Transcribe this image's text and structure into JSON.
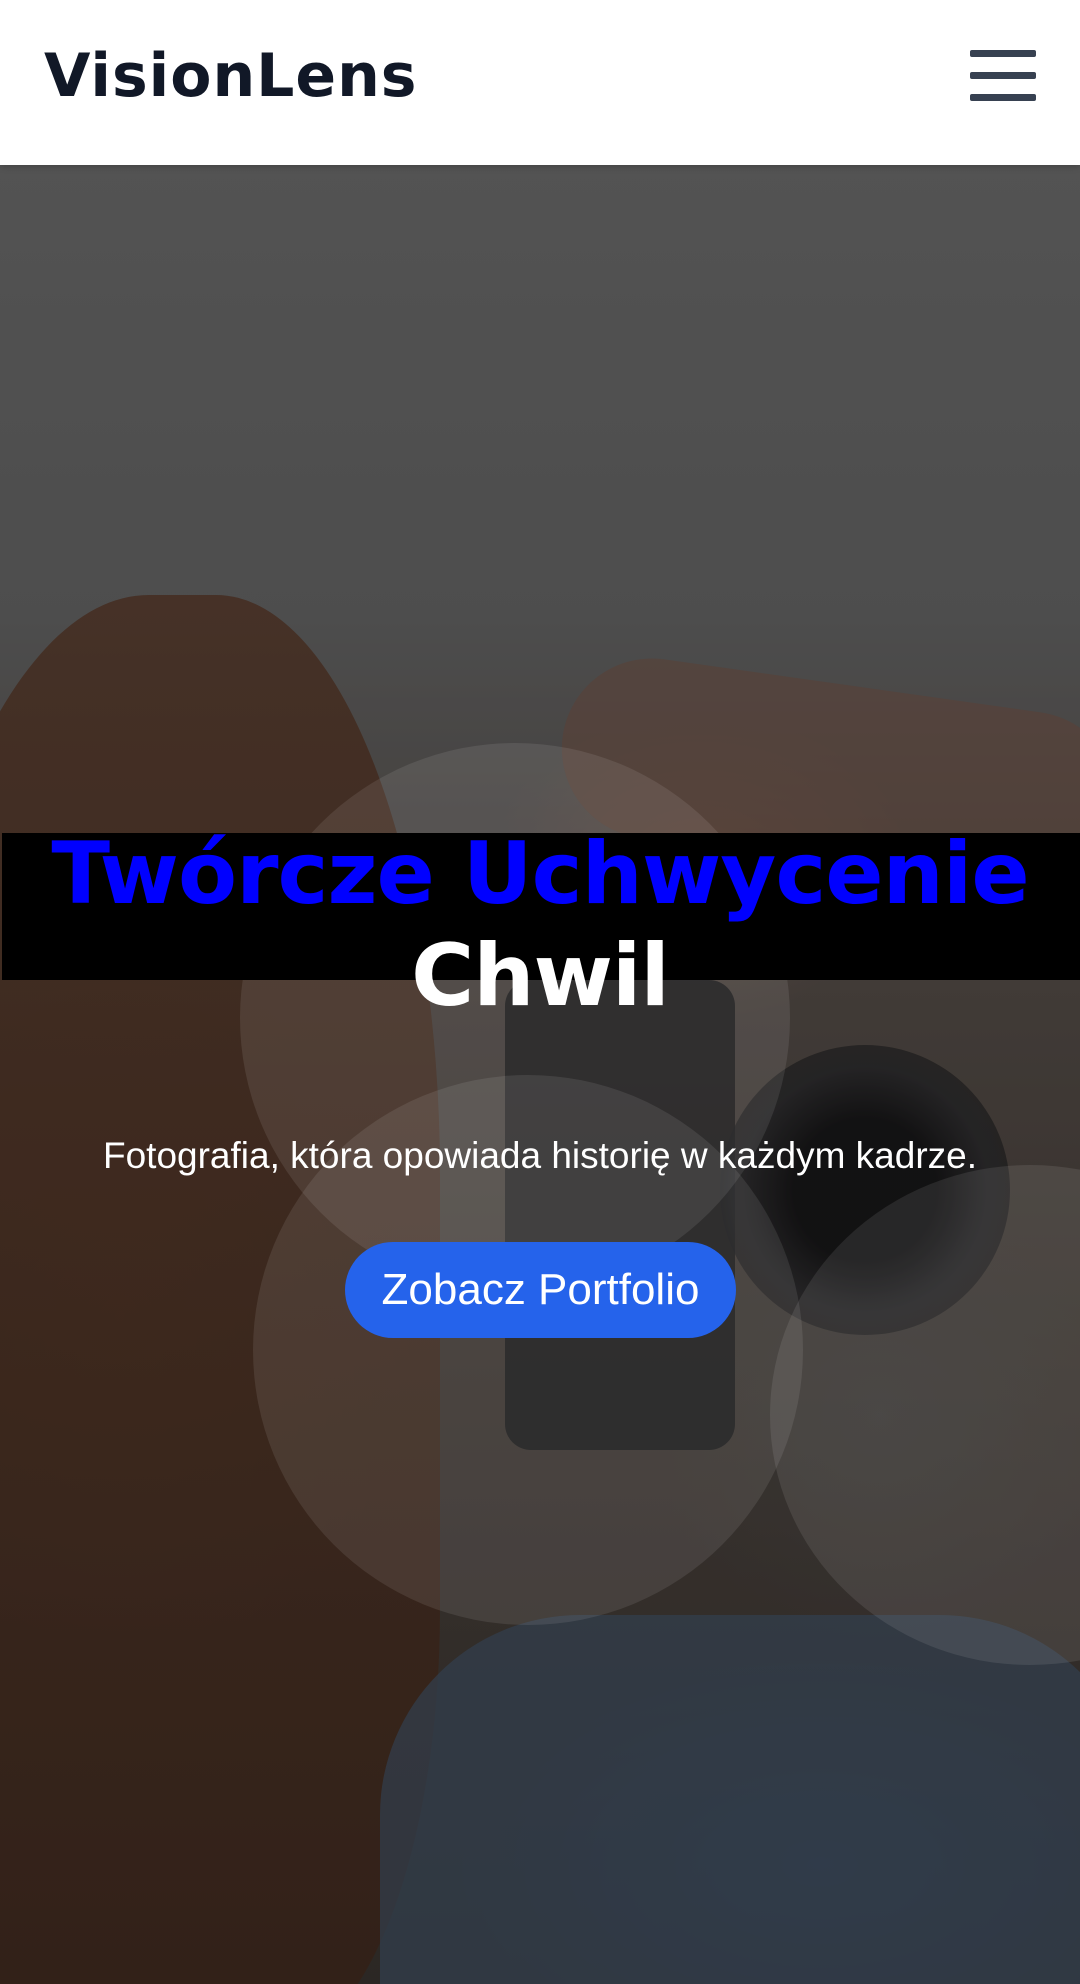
{
  "header": {
    "brand": "VisionLens",
    "menu_icon": "hamburger-menu-icon"
  },
  "hero": {
    "title_line1": "Twórcze Uchwycenie",
    "title_line2": "Chwil",
    "subtitle": "Fotografia, która opowiada historię w każdym kadrze.",
    "cta_label": "Zobacz Portfolio",
    "background_image": "photographer-with-camera-photo"
  },
  "colors": {
    "header_bg": "#ffffff",
    "brand_text": "#111827",
    "title_line1": "#0000ff",
    "title_highlight_bg": "#000000",
    "cta_bg": "#2563eb",
    "cta_text": "#ffffff"
  }
}
